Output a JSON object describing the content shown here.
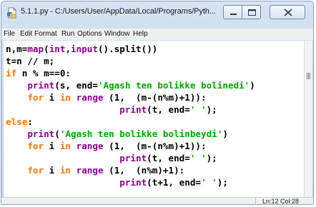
{
  "window": {
    "title": "5.1.1.py - C:/Users/User/AppData/Local/Programs/Pyth..."
  },
  "menu": [
    "File",
    "Edit",
    "Format",
    "Run",
    "Options",
    "Window",
    "Help"
  ],
  "code_lines": [
    [
      {
        "t": "n,m="
      },
      {
        "t": "map",
        "c": "bi"
      },
      {
        "t": "("
      },
      {
        "t": "int",
        "c": "bi"
      },
      {
        "t": ","
      },
      {
        "t": "input",
        "c": "bi"
      },
      {
        "t": "().split())"
      }
    ],
    [
      {
        "t": "t=n // m;"
      }
    ],
    [
      {
        "t": "if",
        "c": "kw"
      },
      {
        "t": " n % m==0:"
      }
    ],
    [
      {
        "t": "    "
      },
      {
        "t": "print",
        "c": "bi"
      },
      {
        "t": "(s, end="
      },
      {
        "t": "'Agash ten bolikke bolinedi'",
        "c": "str"
      },
      {
        "t": ")"
      }
    ],
    [
      {
        "t": "    "
      },
      {
        "t": "for",
        "c": "kw"
      },
      {
        "t": " i "
      },
      {
        "t": "in",
        "c": "kw"
      },
      {
        "t": " "
      },
      {
        "t": "range",
        "c": "bi"
      },
      {
        "t": " (1,  (m-(n%m)+1)):"
      }
    ],
    [
      {
        "t": "                     "
      },
      {
        "t": "print",
        "c": "bi"
      },
      {
        "t": "(t, end="
      },
      {
        "t": "' '",
        "c": "str"
      },
      {
        "t": ");"
      }
    ],
    [
      {
        "t": "else",
        "c": "kw"
      },
      {
        "t": ":"
      }
    ],
    [
      {
        "t": "    "
      },
      {
        "t": "print",
        "c": "bi"
      },
      {
        "t": "("
      },
      {
        "t": "'Agash ten bolikke bolinbeydi'",
        "c": "str"
      },
      {
        "t": ")"
      }
    ],
    [
      {
        "t": "    "
      },
      {
        "t": "for",
        "c": "kw"
      },
      {
        "t": " i "
      },
      {
        "t": "in",
        "c": "kw"
      },
      {
        "t": " "
      },
      {
        "t": "range",
        "c": "bi"
      },
      {
        "t": " (1,  (m-(n%m)+1)):"
      }
    ],
    [
      {
        "t": "                     "
      },
      {
        "t": "print",
        "c": "bi"
      },
      {
        "t": "(t, end="
      },
      {
        "t": "' '",
        "c": "str"
      },
      {
        "t": ");"
      }
    ],
    [
      {
        "t": "    "
      },
      {
        "t": "for",
        "c": "kw"
      },
      {
        "t": " i "
      },
      {
        "t": "in",
        "c": "kw"
      },
      {
        "t": " "
      },
      {
        "t": "range",
        "c": "bi"
      },
      {
        "t": " (1,  (n%m)+1):"
      }
    ],
    [
      {
        "t": "                     "
      },
      {
        "t": "print",
        "c": "bi"
      },
      {
        "t": "(t+1, end="
      },
      {
        "t": "' '",
        "c": "str"
      },
      {
        "t": ");"
      }
    ]
  ],
  "status": {
    "position": "Ln:12  Col:28"
  },
  "colors": {
    "keyword": "#ff7700",
    "builtin": "#900090",
    "string": "#00aa00"
  },
  "icons": [
    "python-file-icon",
    "minimize-icon",
    "maximize-icon",
    "close-icon",
    "scroll-grip-icon"
  ]
}
